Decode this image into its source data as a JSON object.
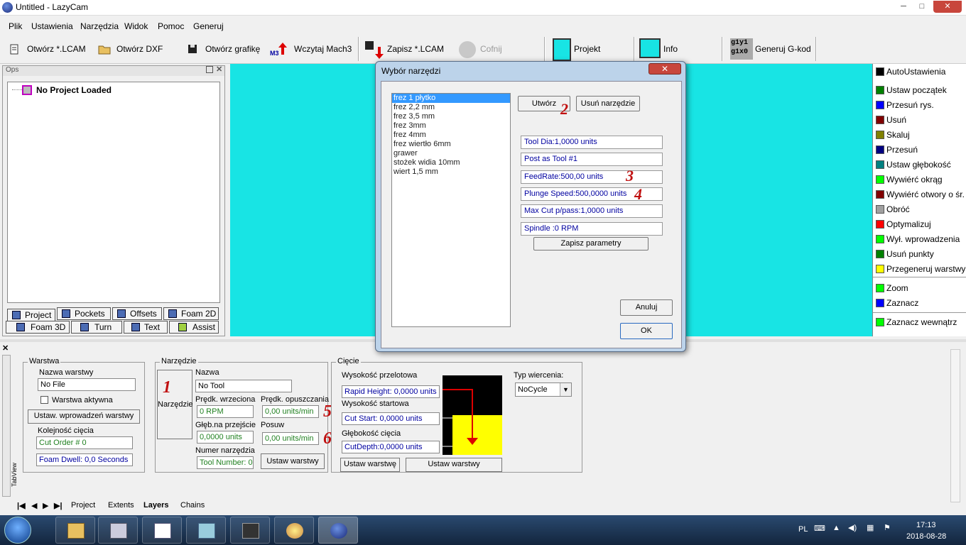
{
  "window": {
    "title": "Untitled - LazyCam",
    "minimize": "─",
    "maximize": "□",
    "close": "✕"
  },
  "menu": [
    "Plik",
    "Ustawienia",
    "Narzędzia",
    "Widok",
    "Pomoc",
    "Generuj"
  ],
  "toolbar": {
    "open_lcam": "Otwórz *.LCAM",
    "open_dxf": "Otwórz DXF",
    "open_graphic": "Otwórz grafikę",
    "load_mach3": "Wczytaj Mach3",
    "mach3_mark": "M3",
    "save_lcam": "Zapisz *.LCAM",
    "undo": "Cofnij",
    "project": "Projekt",
    "info": "Info",
    "gcode_icon_line1": "g1y1",
    "gcode_icon_line2": "g1x0",
    "generate_gcode": "Generuj G-kod"
  },
  "ops": {
    "title": "Ops",
    "tree_root": "No Project Loaded",
    "tabs_row1": [
      "Project",
      "Pockets",
      "Offsets",
      "Foam 2D"
    ],
    "tabs_row2": [
      "Foam 3D",
      "Turn",
      "Text",
      "Assist"
    ]
  },
  "right_panel": {
    "items": [
      {
        "label": "AutoUstawienia",
        "color": "#000000"
      },
      {
        "label": "Ustaw początek",
        "color": "#008000"
      },
      {
        "label": "Przesuń rys.",
        "color": "#0000ff"
      },
      {
        "label": "Usuń",
        "color": "#800000"
      },
      {
        "label": "Skaluj",
        "color": "#808000"
      },
      {
        "label": "Przesuń",
        "color": "#000080"
      },
      {
        "label": "Ustaw głębokość",
        "color": "#008080"
      },
      {
        "label": "Wywiérć okrąg",
        "color": "#00ff00"
      },
      {
        "label": "Wywiérć otwory o śr.",
        "color": "#800000"
      },
      {
        "label": "Obróć",
        "color": "#a0a0a0"
      },
      {
        "label": "Optymalizuj",
        "color": "#ff0000"
      },
      {
        "label": "Wył. wprowadzenia",
        "color": "#00ff00"
      },
      {
        "label": "Usuń punkty",
        "color": "#008000"
      },
      {
        "label": "Przegeneruj warstwy",
        "color": "#ffff00"
      },
      {
        "label": "Zoom",
        "color": "#00ff00"
      },
      {
        "label": "Zaznacz",
        "color": "#0000ff"
      },
      {
        "label": "Zaznacz wewnątrz",
        "color": "#00ff00"
      }
    ]
  },
  "dialog": {
    "title": "Wybór narzędzi",
    "close": "✕",
    "tools": [
      "frez 1 płytko",
      "frez 2,2 mm",
      "frez 3,5 mm",
      "frez 3mm",
      "frez 4mm",
      "frez wiertło 6mm",
      "grawer",
      "stożek widia 10mm",
      "wiert 1,5 mm"
    ],
    "create": "Utwórz",
    "delete_tool": "Usuń narzędzie",
    "tool_dia": "Tool Dia:1,0000 units",
    "post_as_tool": "Post as Tool #1",
    "feedrate": "FeedRate:500,00 units",
    "plunge_speed": "Plunge Speed:500,0000 units",
    "max_cut": "Max Cut p/pass:1,0000 units",
    "spindle": "Spindle :0 RPM",
    "save_params": "Zapisz parametry",
    "cancel": "Anuluj",
    "ok": "OK",
    "marks": [
      "2",
      "3",
      "4"
    ]
  },
  "bottom": {
    "layer": {
      "group": "Warstwa",
      "name_label": "Nazwa warstwy",
      "name_value": "No File",
      "active_label": "Warstwa aktywna",
      "set_leadins": "Ustaw. wprowadzeń warstwy",
      "cut_order_label": "Kolejność cięcia",
      "cut_order": "Cut Order # 0",
      "foam_dwell": "Foam Dwell: 0,0 Seconds"
    },
    "tool": {
      "group": "Narzędzie",
      "tool_button": "Narzędzie",
      "mark1": "1",
      "name_label": "Nazwa",
      "name_value": "No Tool",
      "spindle_label": "Prędk. wrzeciona",
      "spindle_value": "0 RPM",
      "plunge_label": "Prędk. opuszczania",
      "plunge_value": "0,00 units/min",
      "depth_label": "Głęb.na przejście",
      "depth_value": "0,0000 units",
      "feed_label": "Posuw",
      "feed_value": "0,00 units/min",
      "toolnum_label": "Numer narzędzia",
      "toolnum_value": "Tool Number: 0",
      "set_layers": "Ustaw warstwy",
      "mark5": "5",
      "mark6": "6"
    },
    "cut": {
      "group": "Cięcie",
      "rapid_label": "Wysokość przelotowa",
      "rapid_value": "Rapid Height: 0,0000 units",
      "start_label": "Wysokość startowa",
      "start_value": "Cut Start: 0,0000 units",
      "depth_label": "Głębokość cięcia",
      "depth_value": "CutDepth:0,0000 units",
      "drill_label": "Typ wiercenia:",
      "drill_value": "NoCycle",
      "set_layer": "Ustaw warstwę",
      "set_layers": "Ustaw warstwy"
    },
    "tabs": [
      "Project",
      "Extents",
      "Layers",
      "Chains"
    ],
    "tabview": "TabView"
  },
  "taskbar": {
    "lang": "PL",
    "time": "17:13",
    "date": "2018-08-28"
  }
}
